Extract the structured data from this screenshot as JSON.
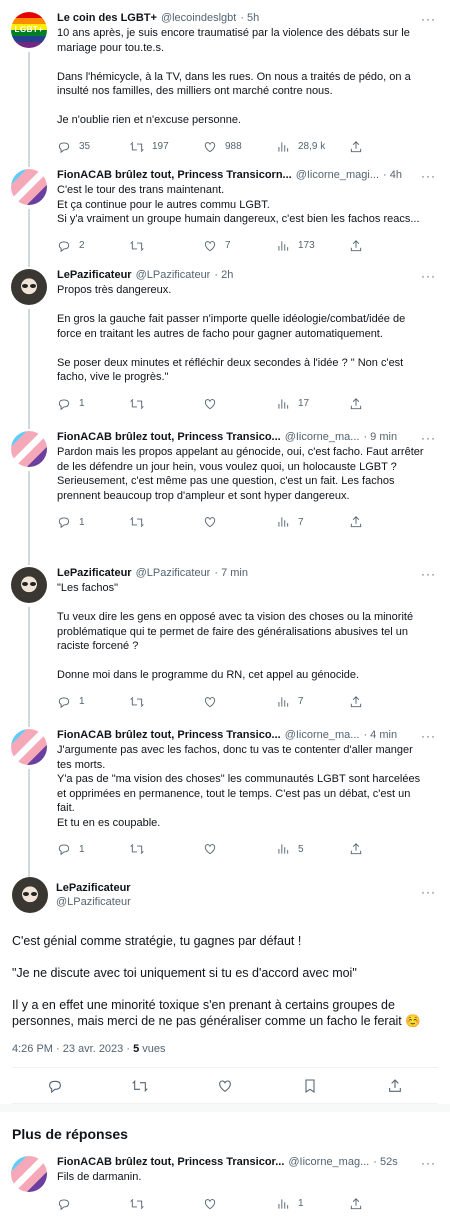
{
  "tweets": [
    {
      "name": "Le coin des LGBT+",
      "handle": "@lecoindeslgbt",
      "time": "· 5h",
      "avatar_text": "LGBT+",
      "body": "10 ans après, je suis encore traumatisé par la violence des débats sur le mariage pour tou.te.s.\n\nDans l'hémicycle, à la TV, dans les rues. On nous a traités de pédo, on a insulté nos familles, des milliers ont marché contre nous.\n\nJe n'oublie rien et n'excuse personne.",
      "replies": "35",
      "retweets": "197",
      "likes": "988",
      "views": "28,9 k"
    },
    {
      "name": "FionACAB brûlez tout, Princess Transicorn...",
      "handle": "@Iicorne_magi...",
      "time": "· 4h",
      "body": "C'est le tour des trans maintenant.\nEt ça continue pour le autres commu LGBT.\nSi y'a vraiment un groupe humain dangereux, c'est bien les fachos reacs...",
      "replies": "2",
      "retweets": "",
      "likes": "7",
      "views": "173"
    },
    {
      "name": "LePazificateur",
      "handle": "@LPazificateur",
      "time": "· 2h",
      "body": "Propos très dangereux.\n\nEn gros la gauche fait passer n'importe quelle idéologie/combat/idée de force en traitant les autres de facho pour gagner automatiquement.\n\nSe poser deux minutes et réfléchir deux secondes à l'idée ? \" Non c'est facho, vive le progrès.\"",
      "replies": "1",
      "retweets": "",
      "likes": "",
      "views": "17"
    },
    {
      "name": "FionACAB brûlez tout, Princess Transico...",
      "handle": "@Iicorne_ma...",
      "time": "· 9 min",
      "body": "Pardon mais les propos appelant au génocide, oui, c'est facho. Faut arrêter de les défendre un jour hein, vous voulez quoi, un holocauste LGBT ?\nSerieusement, c'est même pas une question, c'est un fait. Les fachos prennent beaucoup trop d'ampleur et sont hyper dangereux.",
      "replies": "1",
      "retweets": "",
      "likes": "",
      "views": "7"
    },
    {
      "name": "LePazificateur",
      "handle": "@LPazificateur",
      "time": "· 7 min",
      "body": "\"Les fachos\"\n\nTu veux dire les gens en opposé avec ta vision des choses ou la minorité problématique qui te permet de faire des généralisations abusives tel un raciste forcené ?\n\nDonne moi dans le programme du RN, cet appel au génocide.",
      "replies": "1",
      "retweets": "",
      "likes": "",
      "views": "7"
    },
    {
      "name": "FionACAB brûlez tout, Princess Transico...",
      "handle": "@Iicorne_ma...",
      "time": "· 4 min",
      "body": "J'argumente pas avec les fachos, donc tu vas te contenter d'aller manger tes morts.\nY'a pas de \"ma vision des choses\" les communautés LGBT sont harcelées et opprimées en permanence, tout le temps. C'est pas un débat, c'est un fait.\nEt tu en es coupable.",
      "replies": "1",
      "retweets": "",
      "likes": "",
      "views": "5"
    }
  ],
  "focal": {
    "name": "LePazificateur",
    "handle": "@LPazificateur",
    "body": "C'est génial comme stratégie, tu gagnes par défaut !\n\n\"Je ne discute avec toi uniquement si tu es d'accord avec moi\"\n\nIl y a en effet une minorité toxique s'en prenant à certains groupes de personnes, mais merci de ne pas généraliser comme un facho le ferait ☺️",
    "timestamp": "4:26 PM · 23 avr. 2023 · ",
    "views_count": "5",
    "views_label": " vues"
  },
  "more_replies_title": "Plus de réponses",
  "reply": {
    "name": "FionACAB brûlez tout, Princess Transicor...",
    "handle": "@Iicorne_mag...",
    "time": "· 52s",
    "body": "Fils de darmanin.",
    "replies": "",
    "retweets": "",
    "likes": "",
    "views": "1"
  },
  "more_icon": "···",
  "icons": [
    "reply-icon",
    "retweet-icon",
    "like-icon",
    "views-icon",
    "share-icon",
    "bookmark-icon"
  ]
}
